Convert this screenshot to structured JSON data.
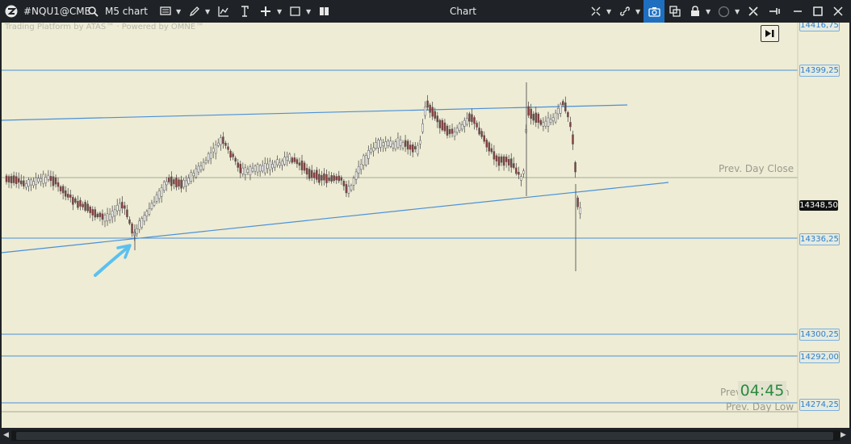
{
  "toolbar": {
    "symbol": "#NQU1@CME",
    "chart_type": "M5 chart",
    "window_title": "Chart",
    "icons": [
      "app-logo-icon",
      "search-icon",
      "template-icon",
      "pencil-icon",
      "indicator-icon",
      "strategy-icon",
      "plus-icon",
      "window-icon",
      "book-icon",
      "crosshair-icon",
      "link-icon",
      "camera-icon",
      "clone-icon",
      "lock-icon",
      "circle-icon",
      "tools-icon",
      "pin-icon",
      "minimize-icon",
      "maximize-icon",
      "close-icon"
    ]
  },
  "watermark": "Trading Platform by ATAS™ · Powered by OMNE™",
  "price_levels": [
    {
      "name": "top",
      "label": "14416,75"
    },
    {
      "name": "level-14399",
      "label": "14399,25"
    },
    {
      "name": "level-14336",
      "label": "14336,25"
    },
    {
      "name": "level-14300",
      "label": "14300,25"
    },
    {
      "name": "level-14292",
      "label": "14292,00"
    },
    {
      "name": "level-14274",
      "label": "14274,25"
    }
  ],
  "current_price": "14348,50",
  "horizontal_labels": {
    "prev_day_close": "Prev. Day Close",
    "prev_day_high_partial": "Prev",
    "prev_day_high_partial_end": "h",
    "prev_day_low": "Prev. Day Low"
  },
  "timer": "04:45",
  "colors": {
    "chart_background": "#eeecd4",
    "level_line": "#4a90d9",
    "candle_up": "#ffffff",
    "candle_down": "#8a3a3a",
    "arrow": "#5bc0f0",
    "timer_text": "#2b8a3e"
  }
}
